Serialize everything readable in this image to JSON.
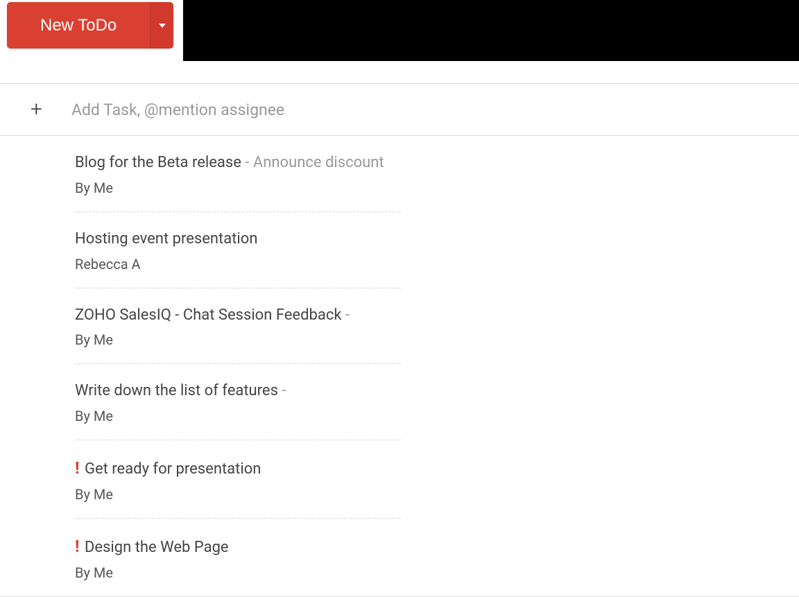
{
  "header": {
    "new_todo_label": "New ToDo"
  },
  "add_task": {
    "placeholder": "Add Task, @mention assignee"
  },
  "tasks": [
    {
      "title": "Blog for the Beta release",
      "suffix": " - Announce discount",
      "assignee": "By Me",
      "priority": false
    },
    {
      "title": "Hosting event presentation",
      "suffix": "",
      "assignee": "Rebecca A",
      "priority": false
    },
    {
      "title": "ZOHO SalesIQ - Chat Session Feedback",
      "suffix": " -",
      "assignee": "By Me",
      "priority": false
    },
    {
      "title": "Write down the list of features",
      "suffix": " -",
      "assignee": "By Me",
      "priority": false
    },
    {
      "title": "Get ready for presentation",
      "suffix": "",
      "assignee": "By Me",
      "priority": true
    },
    {
      "title": "Design the Web Page",
      "suffix": "",
      "assignee": "By Me",
      "priority": true
    }
  ]
}
